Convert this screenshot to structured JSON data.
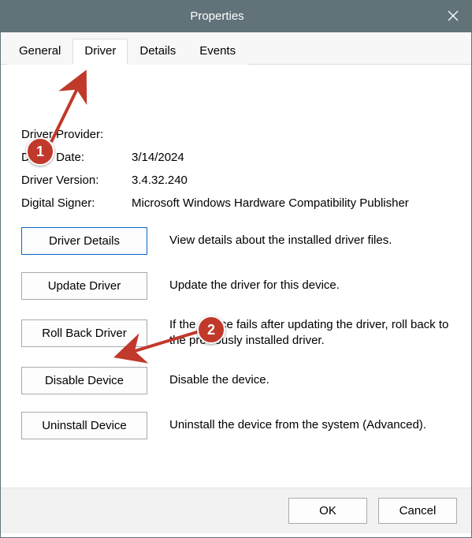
{
  "window": {
    "title": "Properties"
  },
  "tabs": {
    "general": "General",
    "driver": "Driver",
    "details": "Details",
    "events": "Events",
    "active": "driver"
  },
  "info": {
    "provider_label": "Driver Provider:",
    "provider_value": "",
    "date_label": "Driver Date:",
    "date_value": "3/14/2024",
    "version_label": "Driver Version:",
    "version_value": "3.4.32.240",
    "signer_label": "Digital Signer:",
    "signer_value": "Microsoft Windows Hardware Compatibility Publisher"
  },
  "buttons": {
    "details": "Driver Details",
    "details_desc": "View details about the installed driver files.",
    "update": "Update Driver",
    "update_desc": "Update the driver for this device.",
    "rollback": "Roll Back Driver",
    "rollback_desc": "If the device fails after updating the driver, roll back to the previously installed driver.",
    "disable": "Disable Device",
    "disable_desc": "Disable the device.",
    "uninstall": "Uninstall Device",
    "uninstall_desc": "Uninstall the device from the system (Advanced)."
  },
  "footer": {
    "ok": "OK",
    "cancel": "Cancel"
  },
  "annotations": {
    "marker1": "1",
    "marker2": "2"
  }
}
